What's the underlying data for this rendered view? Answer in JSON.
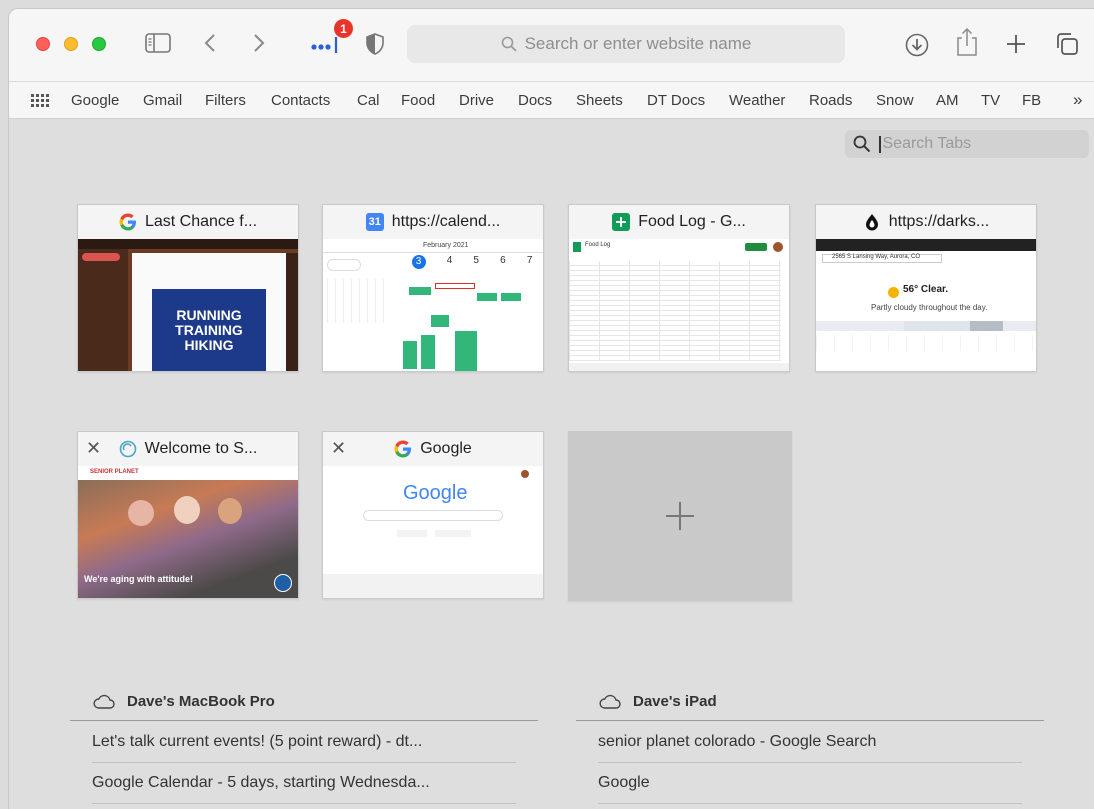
{
  "toolbar": {
    "address_placeholder": "Search or enter website name",
    "badge_count": "1"
  },
  "favorites": [
    "Google",
    "Gmail",
    "Filters",
    "Contacts",
    "Cal",
    "Food",
    "Drive",
    "Docs",
    "Sheets",
    "DT Docs",
    "Weather",
    "Roads",
    "Snow",
    "AM",
    "TV",
    "FB"
  ],
  "search_tabs": {
    "placeholder": "Search Tabs"
  },
  "tabs": [
    {
      "title": "Last Chance f...",
      "icon": "google-icon"
    },
    {
      "title": "https://calend...",
      "icon": "calendar-icon",
      "icon_text": "31"
    },
    {
      "title": "Food Log - G...",
      "icon": "sheets-icon"
    },
    {
      "title": "https://darks...",
      "icon": "darksky-icon"
    },
    {
      "title": "Welcome to S...",
      "icon": "senior-planet-icon"
    },
    {
      "title": "Google",
      "icon": "google-icon"
    }
  ],
  "thumbs": {
    "gmail_banner": [
      "RUNNING",
      "TRAINING",
      "HIKING"
    ],
    "calendar_month": "February 2021",
    "calendar_days": [
      "3",
      "4",
      "5",
      "6",
      "7"
    ],
    "sheet_title": "Food Log",
    "weather_location": "2565 S Lansing Way, Aurora, CO",
    "weather_temp": "56° Clear.",
    "weather_summary": "Partly cloudy throughout the day.",
    "senior_brand": "SENIOR PLANET",
    "senior_headline": "We're aging with attitude!",
    "google_logo": "Google"
  },
  "cloud": {
    "devices": [
      {
        "name": "Dave's MacBook Pro",
        "items": [
          "Let's talk current events! (5 point reward) - dt...",
          "Google Calendar - 5 days, starting Wednesda..."
        ]
      },
      {
        "name": "Dave's iPad",
        "items": [
          "senior planet colorado - Google Search",
          "Google"
        ]
      }
    ]
  },
  "colors": {
    "red": "#fe5f57",
    "yellow": "#febc2e",
    "green": "#28c840",
    "badge": "#e8352b"
  }
}
